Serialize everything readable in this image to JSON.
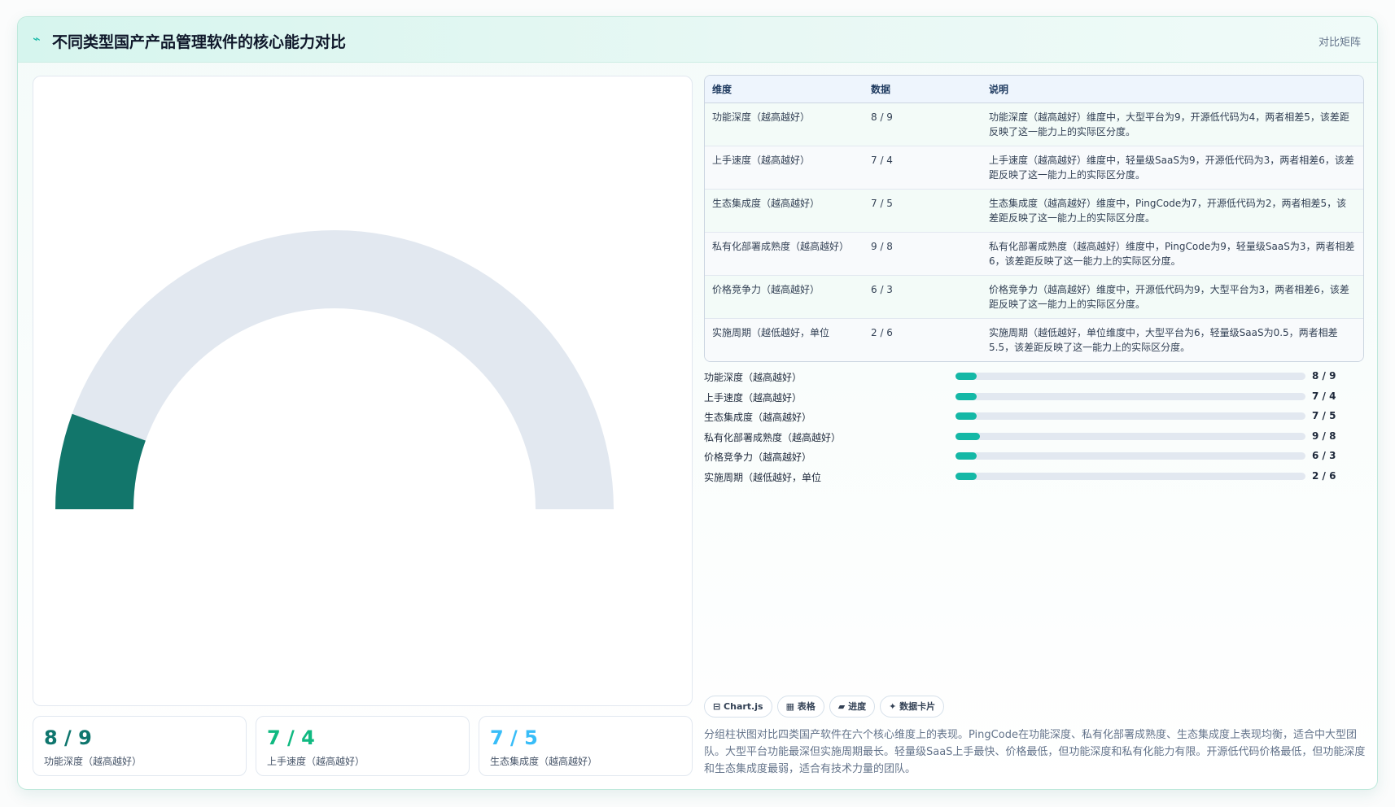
{
  "header": {
    "logo_icon": "wave-icon",
    "title": "不同类型国产产品管理软件的核心能力对比",
    "tag": "对比矩阵"
  },
  "gauge": {
    "value_fraction": 0.111,
    "fill_color": "#12766b",
    "track_color": "#e2e8f0"
  },
  "stats": [
    {
      "value": "8 / 9",
      "label": "功能深度（越高越好）",
      "color": "#0f766e"
    },
    {
      "value": "7 / 4",
      "label": "上手速度（越高越好）",
      "color": "#10b981"
    },
    {
      "value": "7 / 5",
      "label": "生态集成度（越高越好）",
      "color": "#38bdf8"
    }
  ],
  "table": {
    "headers": [
      "维度",
      "数据",
      "说明"
    ],
    "rows": [
      {
        "dim": "功能深度（越高越好）",
        "data": "8 / 9",
        "desc": "功能深度（越高越好）维度中，大型平台为9，开源低代码为4，两者相差5，该差距反映了这一能力上的实际区分度。"
      },
      {
        "dim": "上手速度（越高越好）",
        "data": "7 / 4",
        "desc": "上手速度（越高越好）维度中，轻量级SaaS为9，开源低代码为3，两者相差6，该差距反映了这一能力上的实际区分度。"
      },
      {
        "dim": "生态集成度（越高越好）",
        "data": "7 / 5",
        "desc": "生态集成度（越高越好）维度中，PingCode为7，开源低代码为2，两者相差5，该差距反映了这一能力上的实际区分度。"
      },
      {
        "dim": "私有化部署成熟度（越高越好）",
        "data": "9 / 8",
        "desc": "私有化部署成熟度（越高越好）维度中，PingCode为9，轻量级SaaS为3，两者相差6，该差距反映了这一能力上的实际区分度。"
      },
      {
        "dim": "价格竞争力（越高越好）",
        "data": "6 / 3",
        "desc": "价格竞争力（越高越好）维度中，开源低代码为9，大型平台为3，两者相差6，该差距反映了这一能力上的实际区分度。"
      },
      {
        "dim": "实施周期（越低越好，单位",
        "data": "2 / 6",
        "desc": "实施周期（越低越好，单位维度中，大型平台为6，轻量级SaaS为0.5，两者相差5.5，该差距反映了这一能力上的实际区分度。"
      }
    ]
  },
  "bars": [
    {
      "label": "功能深度（越高越好）",
      "value": "8 / 9",
      "fraction": 0.06
    },
    {
      "label": "上手速度（越高越好）",
      "value": "7 / 4",
      "fraction": 0.06
    },
    {
      "label": "生态集成度（越高越好）",
      "value": "7 / 5",
      "fraction": 0.06
    },
    {
      "label": "私有化部署成熟度（越高越好）",
      "value": "9 / 8",
      "fraction": 0.07
    },
    {
      "label": "价格竞争力（越高越好）",
      "value": "6 / 3",
      "fraction": 0.06
    },
    {
      "label": "实施周期（越低越好，单位",
      "value": "2 / 6",
      "fraction": 0.06
    }
  ],
  "chips": [
    "⊟ Chart.js",
    "▦ 表格",
    "▰ 进度",
    "✦ 数据卡片"
  ],
  "summary": "分组柱状图对比四类国产软件在六个核心维度上的表现。PingCode在功能深度、私有化部署成熟度、生态集成度上表现均衡，适合中大型团队。大型平台功能最深但实施周期最长。轻量级SaaS上手最快、价格最低，但功能深度和私有化能力有限。开源低代码价格最低，但功能深度和生态集成度最弱，适合有技术力量的团队。"
}
